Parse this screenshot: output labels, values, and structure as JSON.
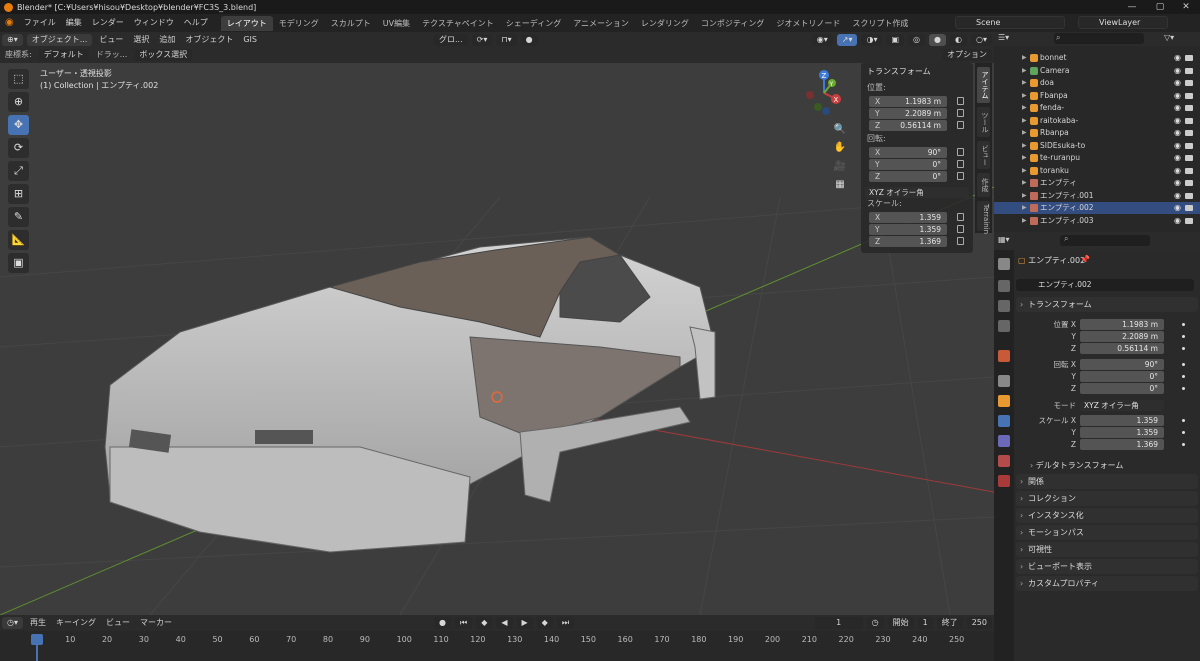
{
  "window": {
    "title": "Blender* [C:¥Users¥hisou¥Desktop¥blender¥FC3S_3.blend]",
    "minimize": "—",
    "maximize": "▢",
    "close": "✕"
  },
  "menus": [
    "ファイル",
    "編集",
    "レンダー",
    "ウィンドウ",
    "ヘルプ"
  ],
  "workspaces": [
    "レイアウト",
    "モデリング",
    "スカルプト",
    "UV編集",
    "テクスチャペイント",
    "シェーディング",
    "アニメーション",
    "レンダリング",
    "コンポジティング",
    "ジオメトリノード",
    "スクリプト作成"
  ],
  "scene": {
    "label": "Scene",
    "view_layer": "ViewLayer"
  },
  "viewport_header": {
    "mode": "オブジェクト...",
    "view": "ビュー",
    "select": "選択",
    "add": "追加",
    "object": "オブジェクト",
    "gis": "GIS",
    "transform_orientation": "グロ..."
  },
  "tool_settings": {
    "orientation_label": "座標系:",
    "orientation_value": "デフォルト",
    "drag_label": "ドラッ...",
    "drag_value": "ボックス選択",
    "options": "オプション"
  },
  "viewport_info": {
    "view_name": "ユーザー・透視投影",
    "collection": "(1) Collection | エンプティ.002"
  },
  "gizmo": {
    "x": "X",
    "y": "Y",
    "z": "Z"
  },
  "n_panel": {
    "header": "トランスフォーム",
    "location_label": "位置:",
    "location": [
      {
        "axis": "X",
        "value": "1.1983 m"
      },
      {
        "axis": "Y",
        "value": "2.2089 m"
      },
      {
        "axis": "Z",
        "value": "0.56114 m"
      }
    ],
    "rotation_label": "回転:",
    "rotation": [
      {
        "axis": "X",
        "value": "90°"
      },
      {
        "axis": "Y",
        "value": "0°"
      },
      {
        "axis": "Z",
        "value": "0°"
      }
    ],
    "rotation_mode": "XYZ オイラー角",
    "scale_label": "スケール:",
    "scale": [
      {
        "axis": "X",
        "value": "1.359"
      },
      {
        "axis": "Y",
        "value": "1.359"
      },
      {
        "axis": "Z",
        "value": "1.369"
      }
    ]
  },
  "side_tabs": [
    "アイテム",
    "ツール",
    "ビュー",
    "作成",
    "Terrainin"
  ],
  "outliner": {
    "items": [
      {
        "name": "bonnet",
        "type": "mesh"
      },
      {
        "name": "Camera",
        "type": "camera"
      },
      {
        "name": "doa",
        "type": "mesh"
      },
      {
        "name": "Fbanpa",
        "type": "mesh"
      },
      {
        "name": "fenda-",
        "type": "mesh"
      },
      {
        "name": "raitokaba-",
        "type": "mesh"
      },
      {
        "name": "Rbanpa",
        "type": "mesh"
      },
      {
        "name": "SIDEsuka-to",
        "type": "mesh"
      },
      {
        "name": "te-ruranpu",
        "type": "mesh"
      },
      {
        "name": "toranku",
        "type": "mesh"
      },
      {
        "name": "エンプティ",
        "type": "empty"
      },
      {
        "name": "エンプティ.001",
        "type": "empty"
      },
      {
        "name": "エンプティ.002",
        "type": "empty",
        "selected": true
      },
      {
        "name": "エンプティ.003",
        "type": "empty"
      }
    ]
  },
  "properties": {
    "object_name": "エンプティ.002",
    "object_field": "エンプティ.002",
    "transform_header": "トランスフォーム",
    "location_x_label": "位置 X",
    "y_label": "Y",
    "z_label": "Z",
    "location": [
      "1.1983 m",
      "2.2089 m",
      "0.56114 m"
    ],
    "rotation_x_label": "回転 X",
    "rotation": [
      "90°",
      "0°",
      "0°"
    ],
    "mode_label": "モード",
    "mode_value": "XYZ オイラー角",
    "scale_x_label": "スケール X",
    "scale": [
      "1.359",
      "1.359",
      "1.369"
    ],
    "delta": "デルタトランスフォーム",
    "sections": [
      "関係",
      "コレクション",
      "インスタンス化",
      "モーションパス",
      "可視性",
      "ビューポート表示",
      "カスタムプロパティ"
    ]
  },
  "timeline": {
    "playback": "再生",
    "keying": "キーイング",
    "view": "ビュー",
    "marker": "マーカー",
    "current_frame": "1",
    "start_label": "開始",
    "start": "1",
    "end_label": "終了",
    "end": "250",
    "ticks": [
      "1",
      "10",
      "20",
      "30",
      "40",
      "50",
      "60",
      "70",
      "80",
      "90",
      "100",
      "110",
      "120",
      "130",
      "140",
      "150",
      "160",
      "170",
      "180",
      "190",
      "200",
      "210",
      "220",
      "230",
      "240",
      "250"
    ]
  },
  "colors": {
    "accent": "#4772b3",
    "selected_row": "#334d80",
    "brand": "#e87d0d"
  }
}
